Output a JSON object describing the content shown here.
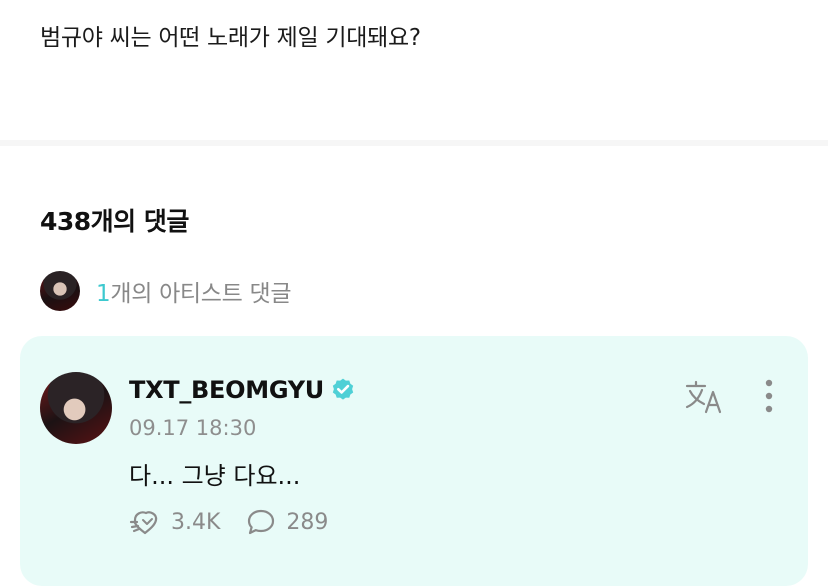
{
  "post": {
    "text": "범규야 씨는 어떤 노래가 제일 기대돼요?"
  },
  "comments": {
    "count_label": "438개의 댓글",
    "artist_summary": {
      "count": "1",
      "label": "개의 아티스트 댓글"
    }
  },
  "comment": {
    "username": "TXT_BEOMGYU",
    "timestamp": "09.17 18:30",
    "body": "다... 그냥 다요...",
    "likes": "3.4K",
    "replies": "289"
  },
  "colors": {
    "accent": "#3dc9cf",
    "card_bg": "#e8fbf8",
    "verified": "#4fd0d6"
  },
  "icons": [
    "verified-icon",
    "translate-icon",
    "more-icon",
    "like-icon",
    "reply-icon"
  ]
}
